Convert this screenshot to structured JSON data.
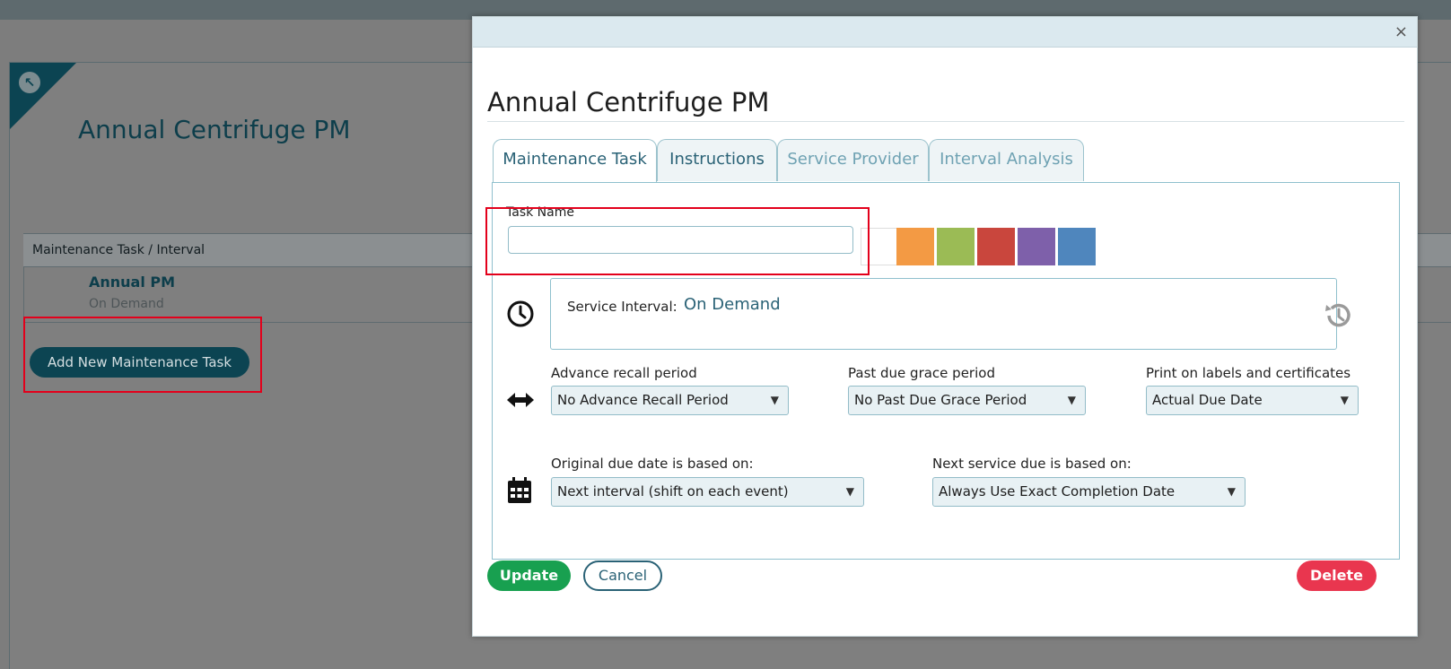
{
  "background": {
    "title": "Annual Centrifuge PM",
    "table_header": "Maintenance Task / Interval",
    "row": {
      "name": "Annual PM",
      "interval": "On Demand"
    },
    "add_button": "Add New Maintenance Task"
  },
  "modal": {
    "close_symbol": "×",
    "title": "Annual Centrifuge PM",
    "tabs": [
      "Maintenance Task",
      "Instructions",
      "Service Provider",
      "Interval Analysis"
    ],
    "active_tab": "Maintenance Task",
    "task_name": {
      "label": "Task Name",
      "value": ""
    },
    "swatch_colors": [
      "#ffffff",
      "#f39a44",
      "#9bbb55",
      "#c9463d",
      "#7e60aa",
      "#4f86bd"
    ],
    "service_interval": {
      "label": "Service Interval:",
      "value": "On Demand"
    },
    "advance_recall": {
      "label": "Advance recall period",
      "value": "No Advance Recall Period"
    },
    "past_due": {
      "label": "Past due grace period",
      "value": "No Past Due Grace Period"
    },
    "print_labels": {
      "label": "Print on labels and certificates",
      "value": "Actual Due Date"
    },
    "original_due": {
      "label": "Original due date is based on:",
      "value": "Next interval (shift on each event)"
    },
    "next_service": {
      "label": "Next service due is based on:",
      "value": "Always Use Exact Completion Date"
    },
    "buttons": {
      "update": "Update",
      "cancel": "Cancel",
      "delete": "Delete"
    }
  },
  "dropdown_arrow": "▼",
  "icons": [
    "clock-icon",
    "history-icon",
    "double-arrow-icon",
    "calendar-icon",
    "expand-arrow-icon"
  ]
}
